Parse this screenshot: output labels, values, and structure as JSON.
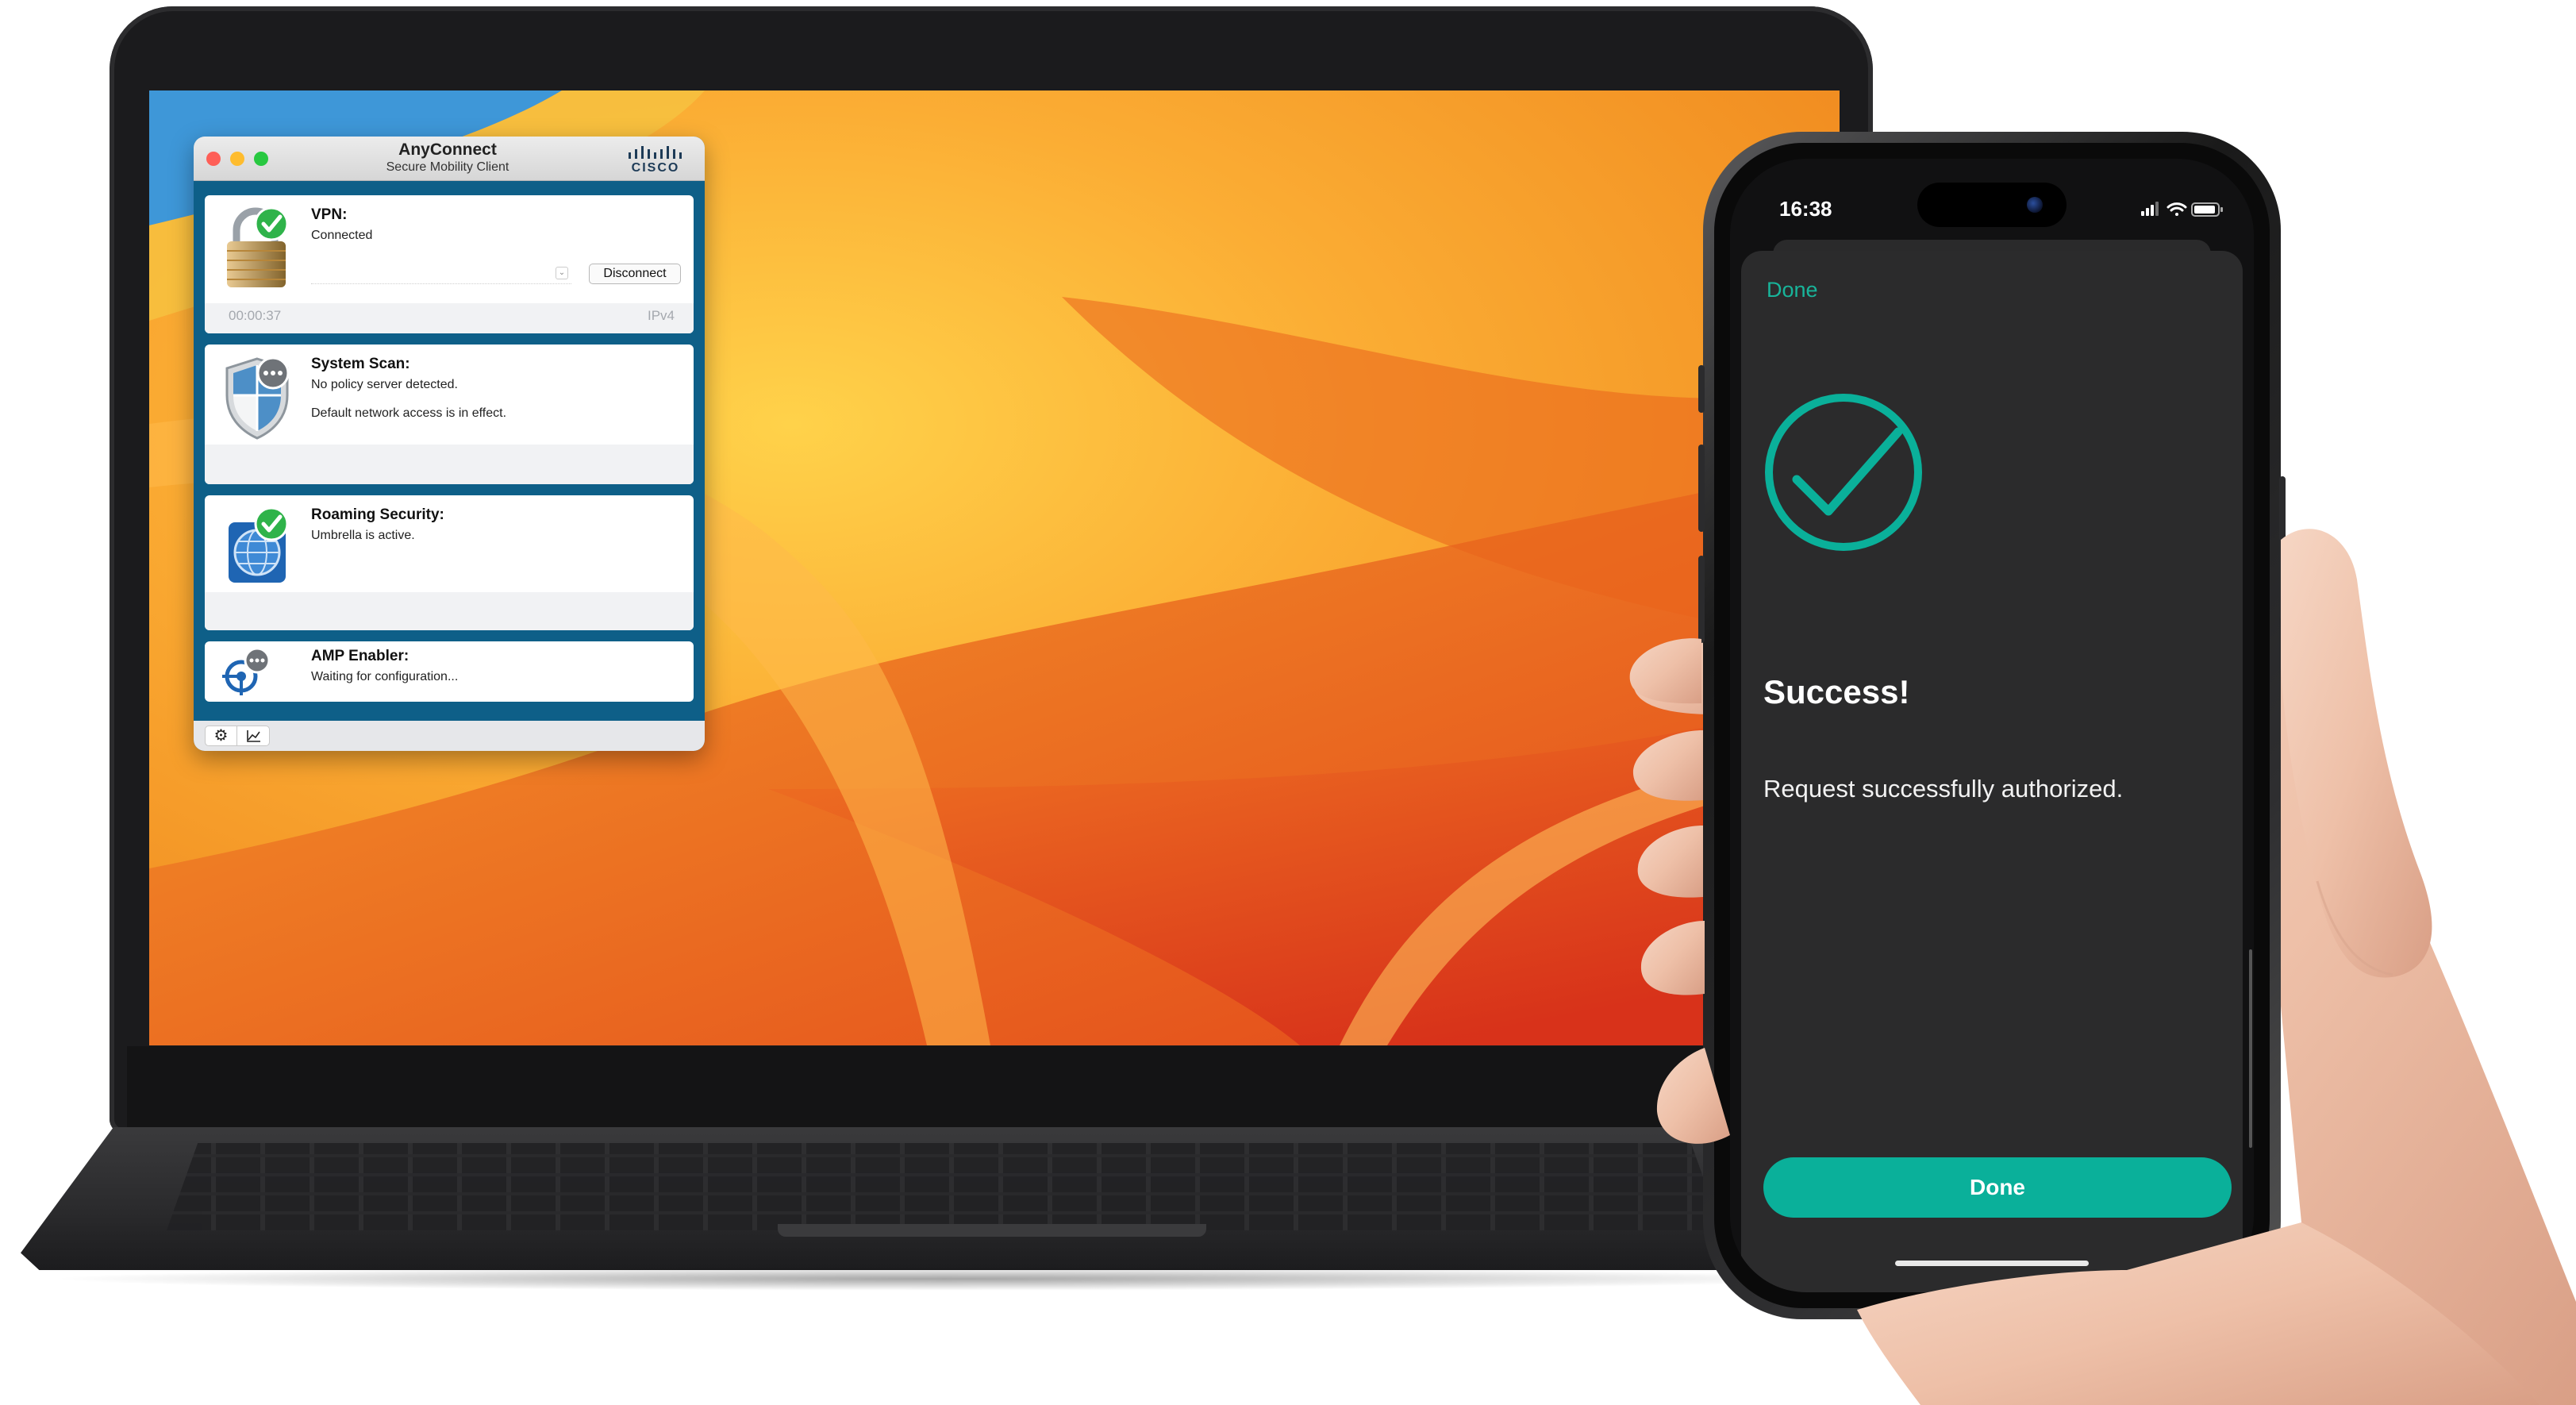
{
  "anyconnect": {
    "title": "AnyConnect",
    "subtitle": "Secure Mobility Client",
    "brand": "CISCO",
    "vpn": {
      "title": "VPN:",
      "status": "Connected",
      "disconnect_label": "Disconnect",
      "timer": "00:00:37",
      "ip_version": "IPv4"
    },
    "system_scan": {
      "title": "System Scan:",
      "line1": "No policy server detected.",
      "line2": "Default network access is in effect."
    },
    "roaming": {
      "title": "Roaming Security:",
      "line1": "Umbrella is active."
    },
    "amp": {
      "title": "AMP Enabler:",
      "line1": "Waiting for configuration..."
    },
    "toolbar": {
      "settings_icon": "gear-icon",
      "stats_icon": "chart-icon"
    }
  },
  "phone": {
    "time": "16:38",
    "sheet": {
      "done_link": "Done",
      "title": "Success!",
      "message": "Request successfully authorized.",
      "done_button": "Done"
    }
  },
  "colors": {
    "accent_teal": "#0ab09a",
    "anyconnect_blue": "#0e5f88",
    "success_green": "#2fb34a"
  }
}
